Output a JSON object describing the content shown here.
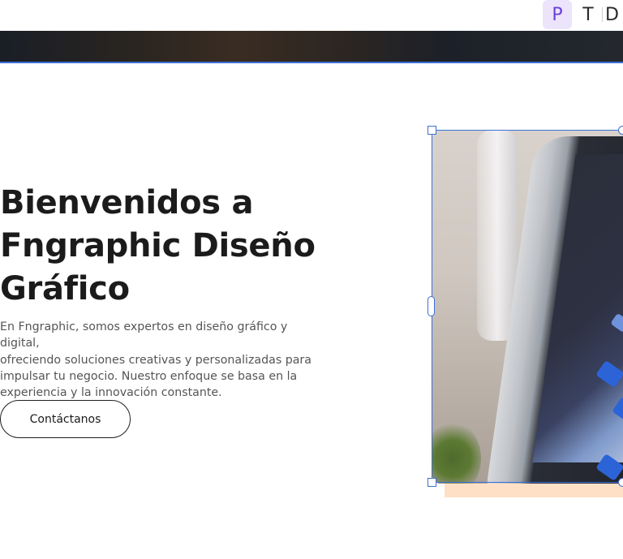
{
  "toolbar": {
    "tools": [
      {
        "label": "P",
        "active": true
      },
      {
        "label": "T",
        "active": false
      },
      {
        "label": "D",
        "active": false
      }
    ]
  },
  "hero": {
    "title_lines": [
      "Bienvenidos a",
      "Fngraphic Diseño",
      "Gráfico"
    ],
    "paragraph_lines": [
      "En Fngraphic, somos expertos en diseño gráfico y digital,",
      "ofreciendo soluciones creativas y personalizadas para",
      "impulsar tu negocio. Nuestro enfoque se basa en la",
      "experiencia y la innovación constante."
    ],
    "cta_label": "Contáctanos"
  },
  "colors": {
    "selection": "#3d6fd6",
    "active_tool_bg": "#ece4fb",
    "active_tool_fg": "#6b3fd6",
    "accent_block": "#fde0c6"
  },
  "icons": {
    "image_subject": "laptop-design-workspace-photo"
  }
}
